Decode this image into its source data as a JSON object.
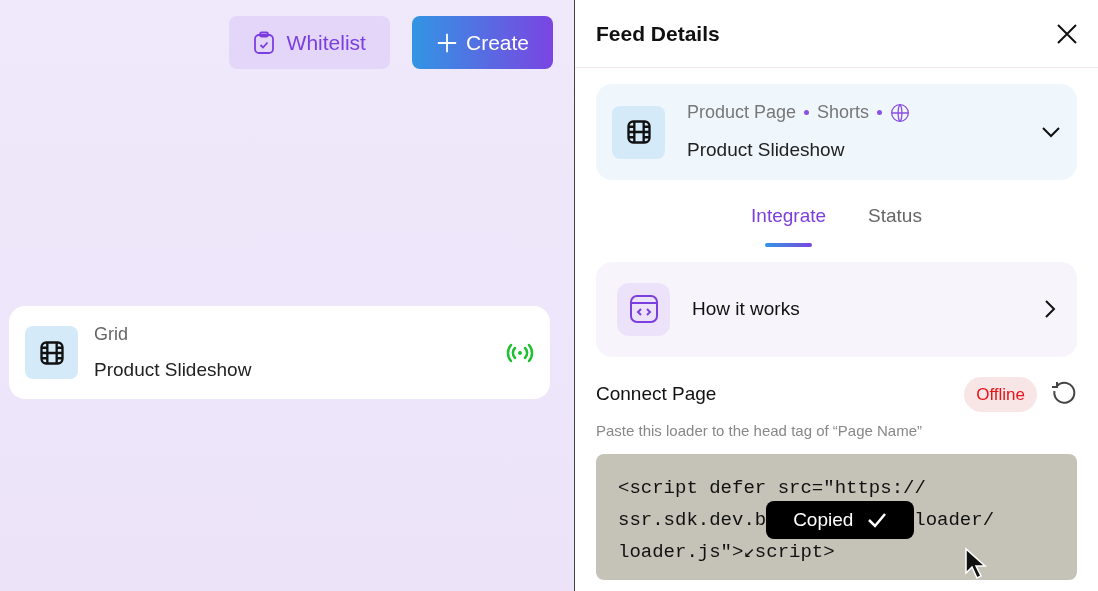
{
  "toolbar": {
    "buttons": [
      {
        "label": "Whitelist",
        "kind": "secondary"
      },
      {
        "label": "Create",
        "kind": "primary"
      }
    ]
  },
  "feeds": [
    {
      "type_label": "Grid",
      "name": "Product Slideshow",
      "live": true
    }
  ],
  "panel": {
    "title": "Feed Details",
    "feed": {
      "page": "Product Page",
      "format": "Shorts",
      "name": "Product Slideshow",
      "expanded": false
    },
    "tabs": [
      {
        "label": "Integrate",
        "selected": true
      },
      {
        "label": "Status",
        "selected": false
      }
    ],
    "how_it_works": {
      "label": "How it works"
    },
    "connect": {
      "title": "Connect Page",
      "status": "Offline",
      "online": false,
      "hint": "Paste this loader to the head tag of “Page Name”",
      "code_lines": [
        [
          "<script defer src=\"https://"
        ],
        [
          "ssr.sdk.dev.b",
          "loader/"
        ],
        [
          "loader.js\">↙script>"
        ]
      ],
      "toast": {
        "label": "Copied"
      }
    }
  }
}
